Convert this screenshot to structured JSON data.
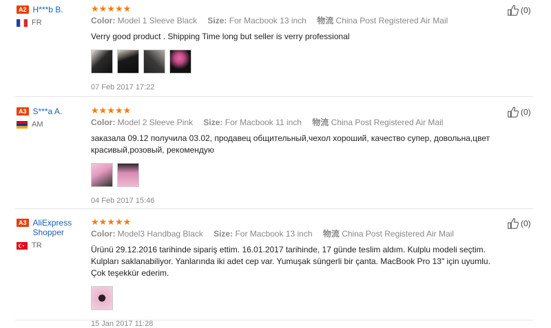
{
  "reviews": [
    {
      "level": "A2",
      "user": "H***b B.",
      "country": "FR",
      "stars": "★★★★★",
      "color_label": "Color:",
      "color_value": "Model 1 Sleeve Black",
      "size_label": "Size:",
      "size_value": "For Macbook 13 inch",
      "ship_label": "物流",
      "ship_value": "China Post Registered Air Mail",
      "text": "Verry good product . Shipping Time long but seller is verry professional",
      "date": "07 Feb 2017 17:22",
      "helpful": "(0)",
      "photo_count": 4
    },
    {
      "level": "A3",
      "user": "S***a A.",
      "country": "AM",
      "stars": "★★★★★",
      "color_label": "Color:",
      "color_value": "Model 2 Sleeve Pink",
      "size_label": "Size:",
      "size_value": "For Macbook 11 inch",
      "ship_label": "物流",
      "ship_value": "China Post Registered Air Mail",
      "text": "заказала 09.12 получила 03.02, продавец общительный,чехол хороший, качество супер, довольна,цвет красивый,розовый, рекомендую",
      "date": "04 Feb 2017 15:46",
      "helpful": "(0)",
      "photo_count": 2
    },
    {
      "level": "A3",
      "user": "AliExpress Shopper",
      "country": "TR",
      "stars": "★★★★★",
      "color_label": "Color:",
      "color_value": "Model3 Handbag Black",
      "size_label": "Size:",
      "size_value": "For Macbook 13 inch",
      "ship_label": "物流",
      "ship_value": "China Post Registered Air Mail",
      "text": "Ürünü 29.12.2016 tarihinde sipariş ettim. 16.01.2017 tarihinde, 17 günde teslim aldım. Kulplu modeli seçtim. Kulpları saklanabiliyor. Yanlarında iki adet cep var. Yumuşak süngerli bir çanta. MacBook Pro 13\" için uyumlu. Çok teşekkür ederim.",
      "date": "15 Jan 2017 11:28",
      "helpful": "(0)",
      "photo_count": 1
    }
  ],
  "colors": {
    "accent": "#e8400c",
    "stars": "#f27d0c",
    "username": "#1a5fb4"
  }
}
